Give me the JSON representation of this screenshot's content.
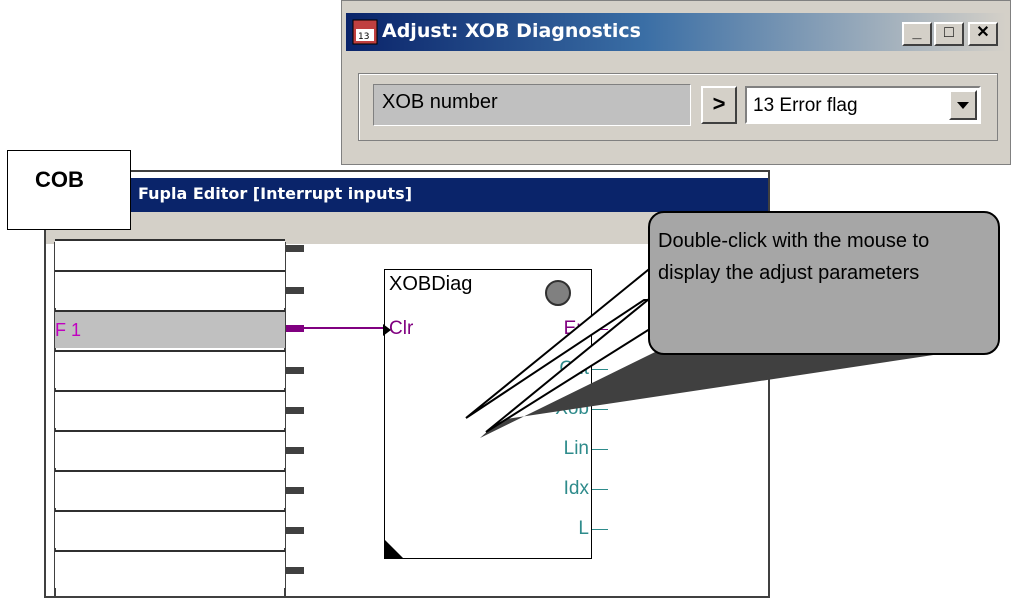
{
  "adjust_dialog": {
    "title": "Adjust: XOB Diagnostics",
    "minimize": "_",
    "maximize": "□",
    "close": "✕",
    "parameter_label": "XOB number",
    "arrow": ">",
    "selected_value": "13 Error flag"
  },
  "editor": {
    "title": "Fupla Editor [Interrupt inputs]",
    "cob_label": "COB",
    "input_rows": [
      "",
      "",
      "F 1",
      "",
      "",
      "",
      "",
      "",
      ""
    ],
    "function_block": {
      "name": "XOBDiag",
      "input": "Clr",
      "outputs": [
        "Err",
        "Cnt",
        "Xob",
        "Lin",
        "Idx",
        "L"
      ],
      "input_color": "#800080",
      "output_color": "#2e8b8b",
      "err_color": "#800080"
    }
  },
  "callout": {
    "text": "Double-click with the mouse to display the adjust parameters"
  }
}
